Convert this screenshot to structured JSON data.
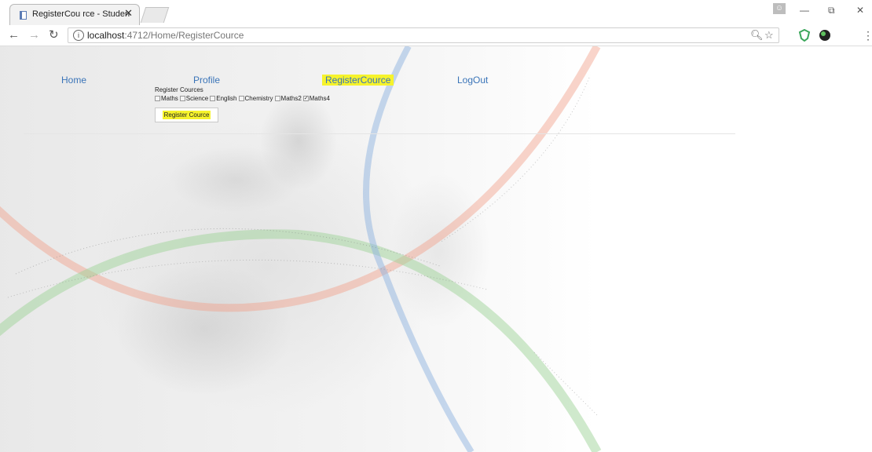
{
  "browser": {
    "tab_title": "RegisterCou rce - Studen",
    "tab_close": "✕",
    "url_host": "localhost",
    "url_path": ":4712/Home/RegisterCource"
  },
  "nav": {
    "home": "Home",
    "profile": "Profile",
    "register": "RegisterCource",
    "logout": "LogOut"
  },
  "form": {
    "title": "Register Cources",
    "courses": [
      {
        "label": "Maths",
        "checked": false
      },
      {
        "label": "Science",
        "checked": false
      },
      {
        "label": "English",
        "checked": false
      },
      {
        "label": "Chemistry",
        "checked": false
      },
      {
        "label": "Maths2",
        "checked": false
      },
      {
        "label": "Maths4",
        "checked": true
      }
    ],
    "submit_label": "Register Cource"
  },
  "colors": {
    "link": "#3a74b8",
    "highlight": "#f6f32c",
    "arc_red": "#f2a08a",
    "arc_green": "#9fd39a",
    "arc_blue": "#8fb4e0"
  }
}
